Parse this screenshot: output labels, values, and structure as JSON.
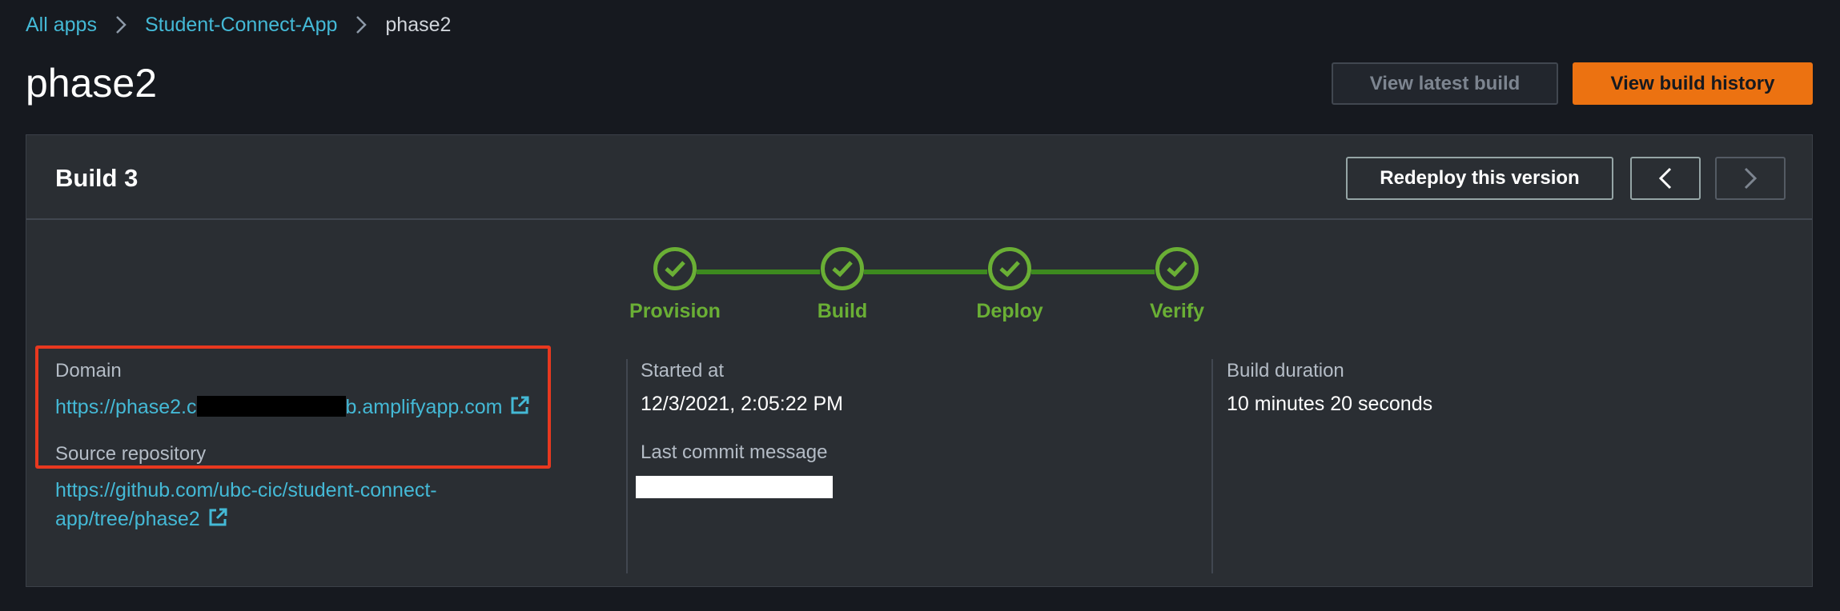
{
  "breadcrumb": {
    "items": [
      "All apps",
      "Student-Connect-App"
    ],
    "current": "phase2"
  },
  "page": {
    "title": "phase2"
  },
  "header_buttons": {
    "view_latest_build": "View latest build",
    "view_build_history": "View build history"
  },
  "build": {
    "title": "Build 3",
    "redeploy_label": "Redeploy this version",
    "steps": [
      "Provision",
      "Build",
      "Deploy",
      "Verify"
    ],
    "domain": {
      "label": "Domain",
      "url_prefix": "https://phase2.c",
      "url_suffix": "b.amplifyapp.com"
    },
    "source_repository": {
      "label": "Source repository",
      "url_line1": "https://github.com/ubc-cic/student-connect-",
      "url_line2": "app/tree/phase2"
    },
    "started_at": {
      "label": "Started at",
      "value": "12/3/2021, 2:05:22 PM"
    },
    "last_commit": {
      "label": "Last commit message"
    },
    "build_duration": {
      "label": "Build duration",
      "value": "10 minutes 20 seconds"
    }
  },
  "colors": {
    "accent": "#ec7211",
    "link": "#44b9d6",
    "success": "#6aaf35",
    "highlight": "#e8381f"
  },
  "icons": [
    "chevron-right-icon",
    "chevron-left-icon",
    "check-icon",
    "external-link-icon"
  ]
}
